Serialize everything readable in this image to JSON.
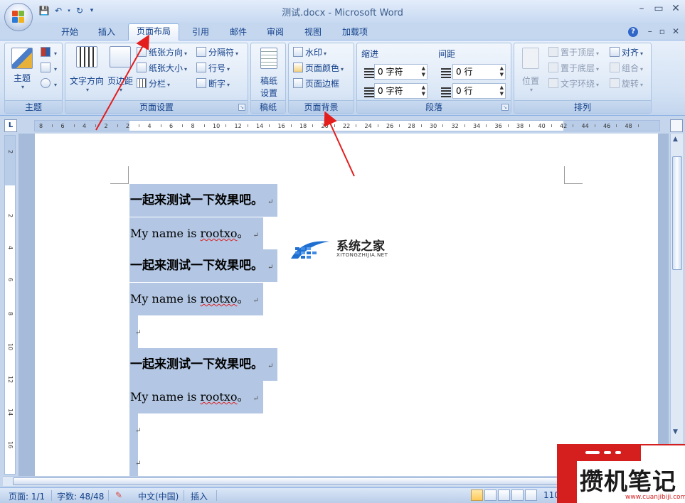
{
  "window": {
    "title": "测试.docx - Microsoft Word"
  },
  "tabs": [
    {
      "label": "开始"
    },
    {
      "label": "插入"
    },
    {
      "label": "页面布局"
    },
    {
      "label": "引用"
    },
    {
      "label": "邮件"
    },
    {
      "label": "审阅"
    },
    {
      "label": "视图"
    },
    {
      "label": "加载项"
    }
  ],
  "ribbon": {
    "theme": {
      "label": "主题",
      "btn": "主题"
    },
    "page_setup": {
      "label": "页面设置",
      "text_direction": "文字方向",
      "margins": "页边距",
      "orientation": "纸张方向",
      "size": "纸张大小",
      "columns": "分栏",
      "breaks": "分隔符",
      "line_numbers": "行号",
      "hyphenation": "断字"
    },
    "manuscript": {
      "label": "稿纸",
      "btn_line1": "稿纸",
      "btn_line2": "设置"
    },
    "page_background": {
      "label": "页面背景",
      "watermark": "水印",
      "page_color": "页面颜色",
      "page_borders": "页面边框"
    },
    "paragraph": {
      "label": "段落",
      "indent": "缩进",
      "spacing": "间距",
      "indent_left": "0 字符",
      "indent_right": "0 字符",
      "spacing_before": "0 行",
      "spacing_after": "0 行"
    },
    "arrange": {
      "label": "排列",
      "position": "位置",
      "bring_front": "置于顶层",
      "send_back": "置于底层",
      "text_wrap": "文字环绕",
      "align": "对齐",
      "group": "组合",
      "rotate": "旋转"
    }
  },
  "ruler": {
    "h_ticks": [
      "8",
      "6",
      "4",
      "2",
      "2",
      "4",
      "6",
      "8",
      "10",
      "12",
      "14",
      "16",
      "18",
      "20",
      "22",
      "24",
      "26",
      "28",
      "30",
      "32",
      "34",
      "36",
      "38",
      "40",
      "42",
      "44",
      "46",
      "48"
    ],
    "v_ticks": [
      "2",
      "2",
      "4",
      "6",
      "8",
      "10",
      "12",
      "14",
      "16"
    ]
  },
  "document": {
    "paragraphs": [
      {
        "kind": "cn",
        "text": "一起来测试一下效果吧。",
        "mark": "↵"
      },
      {
        "kind": "en",
        "pre": "My name is ",
        "word": "rootxo",
        "post": "。",
        "mark": "↵"
      },
      {
        "kind": "cn",
        "text": "一起来测试一下效果吧。",
        "mark": "↵"
      },
      {
        "kind": "en",
        "pre": "My name is ",
        "word": "rootxo",
        "post": "。",
        "mark": "↵"
      },
      {
        "kind": "empty",
        "mark": "↵"
      },
      {
        "kind": "cn",
        "text": "一起来测试一下效果吧。",
        "mark": "↵"
      },
      {
        "kind": "en",
        "pre": "My name is ",
        "word": "rootxo",
        "post": "。",
        "mark": "↵"
      },
      {
        "kind": "empty",
        "mark": "↵"
      },
      {
        "kind": "empty",
        "mark": "↵"
      }
    ]
  },
  "statusbar": {
    "page": "页面: 1/1",
    "words": "字数: 48/48",
    "language": "中文(中国)",
    "mode": "插入",
    "zoom": "110"
  },
  "watermarks": {
    "site1_name": "系统之家",
    "site1_url": "XITONGZHIJIA.NET",
    "site2_name": "攒机笔记",
    "site2_url": "www.cuanjibiji.com"
  },
  "colors": {
    "annotation_arrow": "#e41d1d",
    "selection": "#b3c7e4",
    "ribbon_bg": "#d2e1f4"
  }
}
